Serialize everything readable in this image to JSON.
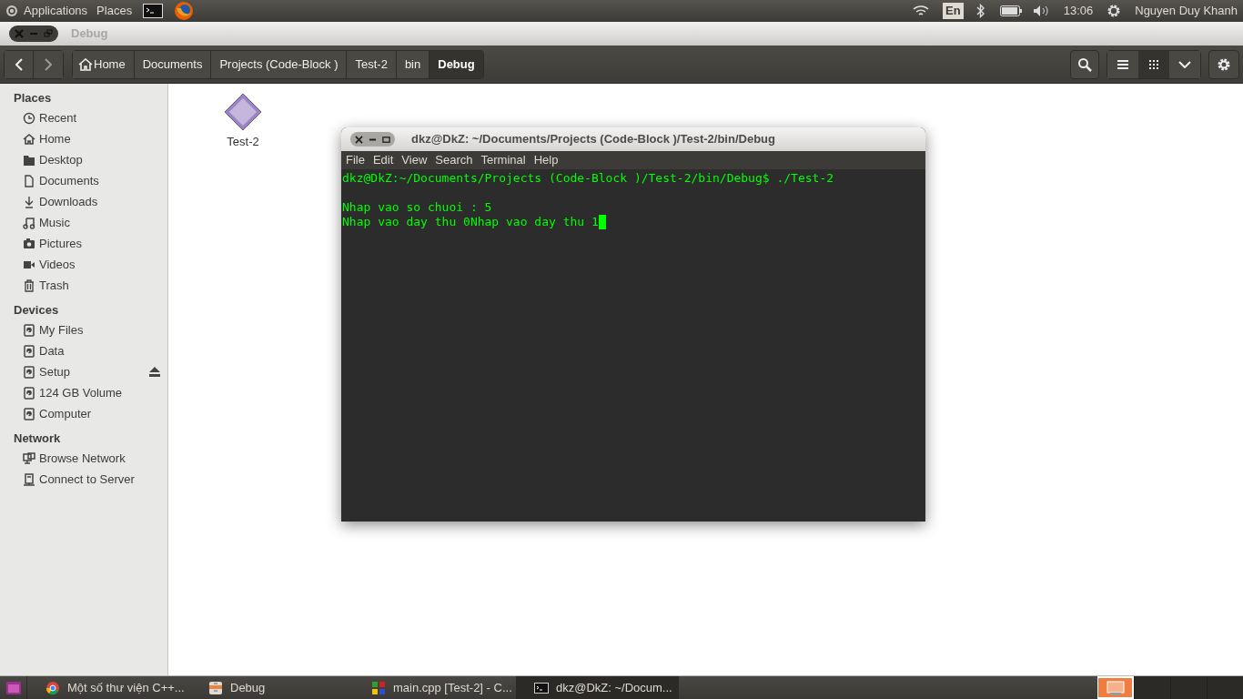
{
  "top_panel": {
    "menus": [
      "Applications",
      "Places"
    ],
    "keyboard_layout": "En",
    "clock": "13:06",
    "user": "Nguyen Duy Khanh"
  },
  "window": {
    "title": "Debug"
  },
  "path_bar": [
    {
      "label": "Home",
      "selected": false
    },
    {
      "label": "Documents",
      "selected": false
    },
    {
      "label": "Projects (Code-Block )",
      "selected": false
    },
    {
      "label": "Test-2",
      "selected": false
    },
    {
      "label": "bin",
      "selected": false
    },
    {
      "label": "Debug",
      "selected": true
    }
  ],
  "sidebar": [
    {
      "heading": "Places",
      "items": [
        {
          "label": "Recent",
          "ejectable": false
        },
        {
          "label": "Home",
          "ejectable": false
        },
        {
          "label": "Desktop",
          "ejectable": false
        },
        {
          "label": "Documents",
          "ejectable": false
        },
        {
          "label": "Downloads",
          "ejectable": false
        },
        {
          "label": "Music",
          "ejectable": false
        },
        {
          "label": "Pictures",
          "ejectable": false
        },
        {
          "label": "Videos",
          "ejectable": false
        },
        {
          "label": "Trash",
          "ejectable": false
        }
      ]
    },
    {
      "heading": "Devices",
      "items": [
        {
          "label": "My Files",
          "ejectable": false
        },
        {
          "label": "Data",
          "ejectable": false
        },
        {
          "label": "Setup",
          "ejectable": true
        },
        {
          "label": "124 GB Volume",
          "ejectable": false
        },
        {
          "label": "Computer",
          "ejectable": false
        }
      ]
    },
    {
      "heading": "Network",
      "items": [
        {
          "label": "Browse Network",
          "ejectable": false
        },
        {
          "label": "Connect to Server",
          "ejectable": false
        }
      ]
    }
  ],
  "files": [
    {
      "name": "Test-2"
    }
  ],
  "terminal": {
    "title": "dkz@DkZ: ~/Documents/Projects (Code-Block )/Test-2/bin/Debug",
    "menu": [
      "File",
      "Edit",
      "View",
      "Search",
      "Terminal",
      "Help"
    ],
    "command_line": "dkz@DkZ:~/Documents/Projects (Code-Block )/Test-2/bin/Debug$ ./Test-2",
    "output_lines": [
      "Nhap vao so chuoi : 5",
      "Nhap vao day thu 0Nhap vao day thu 1"
    ]
  },
  "taskbar": {
    "items": [
      {
        "label": "Một số thư viện C++...",
        "selected": false
      },
      {
        "label": "Debug",
        "selected": false
      },
      {
        "label": "main.cpp [Test-2] - C...",
        "selected": false
      },
      {
        "label": "dkz@DkZ: ~/Docum...",
        "selected": true
      }
    ],
    "workspaces": [
      {
        "selected": true
      },
      {
        "selected": false
      },
      {
        "selected": false
      },
      {
        "selected": false
      }
    ]
  }
}
